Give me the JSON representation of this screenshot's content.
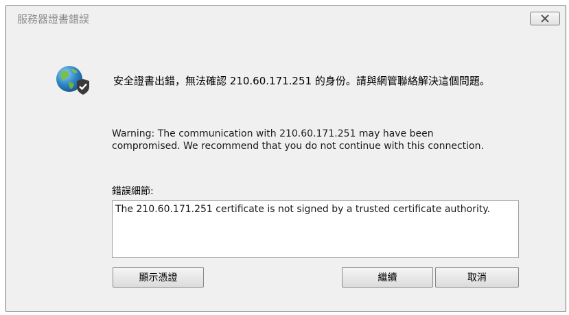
{
  "window": {
    "title": "服務器證書錯誤"
  },
  "message": {
    "headline": "安全證書出錯，無法確認 210.60.171.251 的身份。請與網管聯絡解決這個問題。",
    "warning": "Warning: The communication with 210.60.171.251 may have been compromised. We recommend that you do not continue with this connection."
  },
  "details": {
    "label": "錯誤細節:",
    "text": "The 210.60.171.251 certificate is not signed by a trusted certificate authority."
  },
  "buttons": {
    "view_certificate": "顯示憑證",
    "continue": "繼續",
    "cancel": "取消"
  },
  "icons": {
    "security": "globe-shield-icon",
    "close": "close-icon"
  }
}
